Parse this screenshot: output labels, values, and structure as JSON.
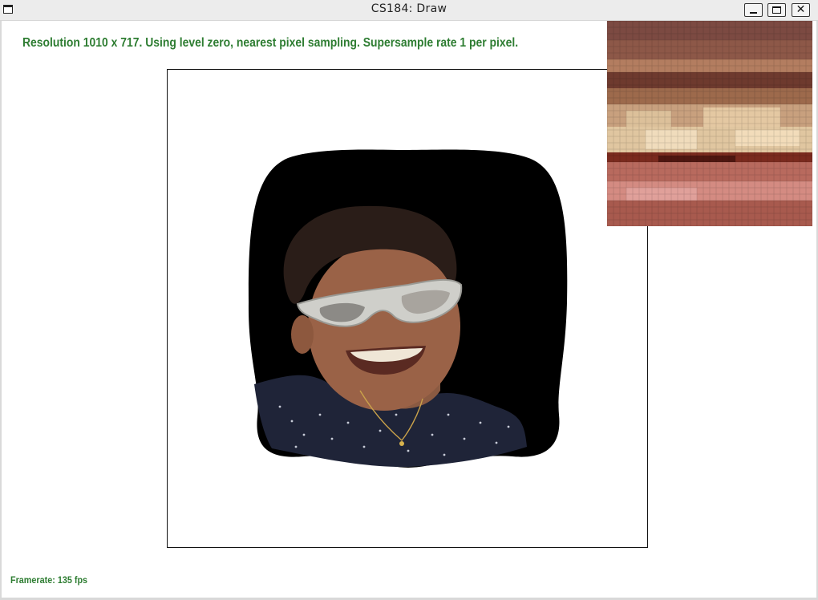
{
  "window": {
    "title": "CS184: Draw"
  },
  "icons": {
    "app": "window-icon",
    "minimize": "minimize-icon",
    "maximize": "maximize-icon",
    "close": "close-icon"
  },
  "close_glyph": "✕",
  "status": {
    "info_text": "Resolution 1010 x 717. Using level zero, nearest pixel sampling. Supersample rate 1 per pixel.",
    "framerate_text": "Framerate: 135 fps"
  },
  "colors": {
    "status_text": "#2e7d32",
    "canvas_border": "#111111",
    "background": "#ffffff"
  }
}
